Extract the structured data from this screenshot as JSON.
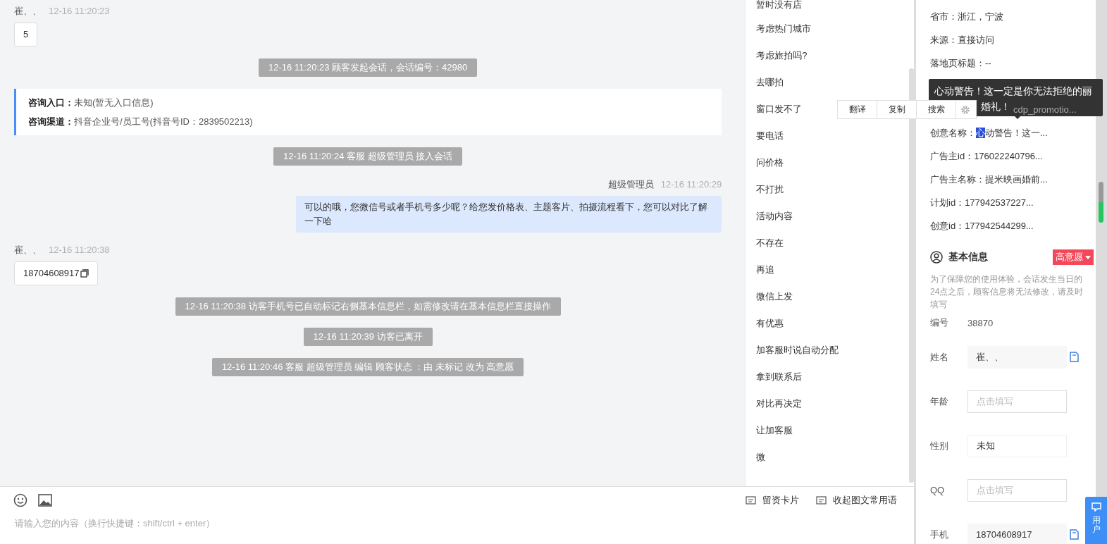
{
  "chat": {
    "messages": [
      {
        "kind": "visitor",
        "name": "崔、、",
        "time": "12-16 11:20:23",
        "text": "5",
        "copy": false
      },
      {
        "kind": "system",
        "text": "12-16 11:20:23 顾客发起会话，会话编号：42980"
      },
      {
        "kind": "card",
        "lines": [
          "**咨询入口：**未知(暂无入口信息)",
          "**咨询渠道：**抖音企业号/员工号(抖音号ID：2839502213)"
        ]
      },
      {
        "kind": "system",
        "text": "12-16 11:20:24 客服 超级管理员 接入会话"
      },
      {
        "kind": "agent",
        "name": "超级管理员",
        "time": "12-16 11:20:29",
        "text": "可以的哦，您微信号或者手机号多少呢？给您发价格表、主题客片、拍摄流程看下，您可以对比了解一下哈"
      },
      {
        "kind": "visitor",
        "name": "崔、、",
        "time": "12-16 11:20:38",
        "text": "18704608917",
        "copy": true
      },
      {
        "kind": "system",
        "text": "12-16 11:20:38 访客手机号已自动标记右侧基本信息栏，如需修改请在基本信息栏直接操作"
      },
      {
        "kind": "system",
        "text": "12-16 11:20:39 访客已离开"
      },
      {
        "kind": "system",
        "text": "12-16 11:20:46 客服 超级管理员 编辑 顾客状态 ：由 未标记 改为 高意愿"
      }
    ]
  },
  "composer": {
    "placeholder": "请输入您的内容（换行快捷键：shift/ctrl + enter）",
    "buttons": [
      "留资卡片",
      "收起图文常用语"
    ]
  },
  "quick_replies": [
    "暂时没有店",
    "考虑热门城市",
    "考虑旅拍吗?",
    "去哪拍",
    "窗口发不了",
    "要电话",
    "问价格",
    "不打扰",
    "活动内容",
    "不存在",
    "再追",
    "微信上发",
    "有优惠",
    "加客服时说自动分配",
    "拿到联系后",
    "对比再决定",
    "让加客服",
    "微"
  ],
  "context_menu": {
    "items": [
      "翻译",
      "复制",
      "搜索"
    ]
  },
  "tooltip": {
    "lines": [
      "心动警告！这一定是你无法拒绝的丽",
      "婚礼！"
    ]
  },
  "visit_info": [
    {
      "label": "省市：",
      "value": "浙江，宁波"
    },
    {
      "label": "来源：",
      "value": "直接访问"
    },
    {
      "label": "落地页标题：",
      "value": "--"
    },
    {
      "value": "cdp_promotio..."
    },
    {
      "label": "创意名称：",
      "selected_text": "心",
      "value": "动警告！这一..."
    },
    {
      "label": "广告主id：",
      "value": "176022240796..."
    },
    {
      "label": "广告主名称：",
      "value": "提米映画婚前..."
    },
    {
      "label": "计划id：",
      "value": "177942537227..."
    },
    {
      "label": "创意id：",
      "value": "177942544299..."
    }
  ],
  "basic_info": {
    "title": "基本信息",
    "tag": "高意愿",
    "note": "为了保障您的使用体验，会话发生当日的24点之后，顾客信息将无法修改，请及时填写",
    "fields": [
      {
        "kind": "plain",
        "label": "编号",
        "value": "38870"
      },
      {
        "kind": "readonly",
        "label": "姓名",
        "value": "崔、、",
        "copy": true
      },
      {
        "kind": "input",
        "label": "年龄",
        "placeholder": "点击填写"
      },
      {
        "kind": "select",
        "label": "性别",
        "value": "未知"
      },
      {
        "kind": "input",
        "label": "QQ",
        "placeholder": "点击填写"
      },
      {
        "kind": "readonly",
        "label": "手机",
        "value": "18704608917",
        "copy": true
      }
    ]
  },
  "feedback_tab": {
    "label": "用户"
  }
}
